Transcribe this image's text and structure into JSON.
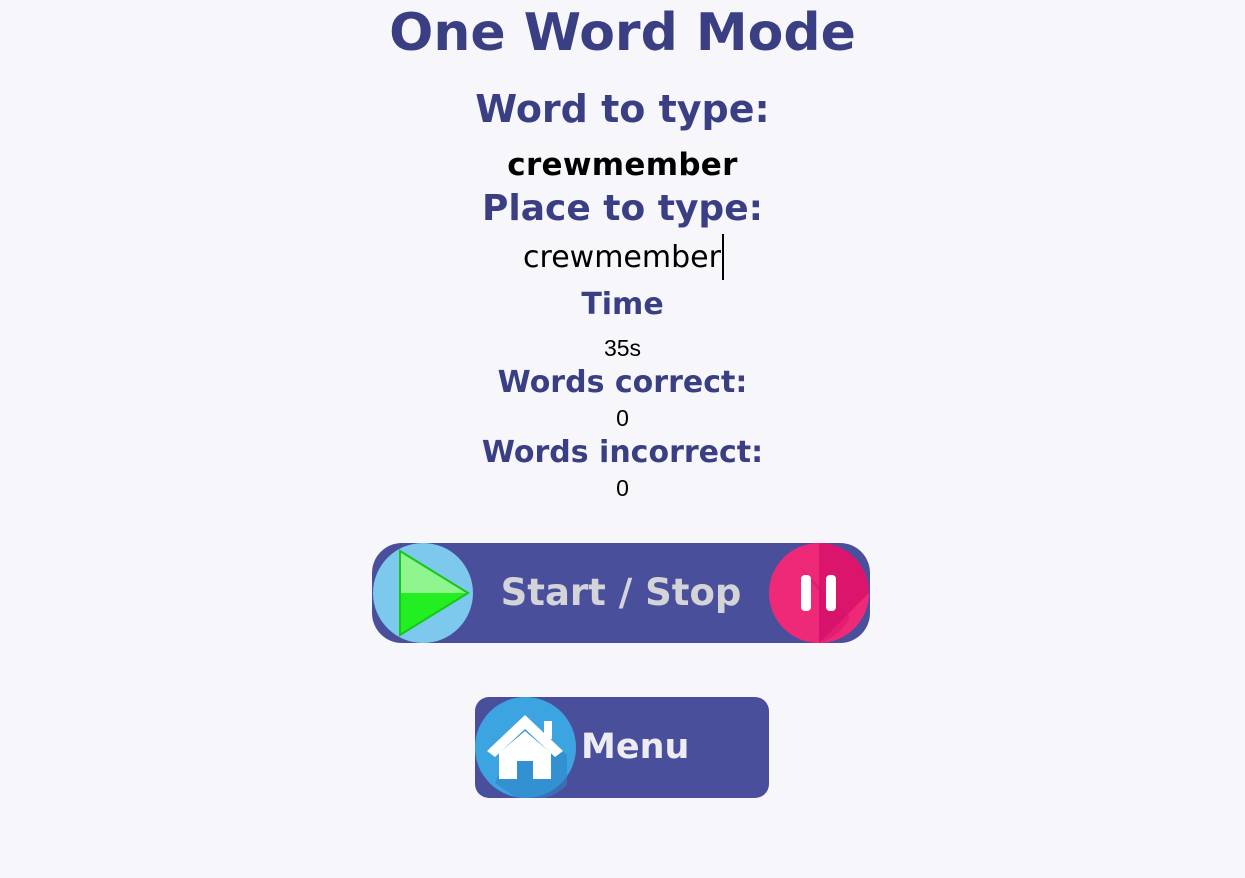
{
  "page": {
    "title": "One Word Mode"
  },
  "word_to_type": {
    "label": "Word to type:",
    "word": "crewmember"
  },
  "place_to_type": {
    "label": "Place to type:",
    "value": "crewmember"
  },
  "time": {
    "label": "Time",
    "value": "35s"
  },
  "words_correct": {
    "label": "Words correct:",
    "value": "0"
  },
  "words_incorrect": {
    "label": "Words incorrect:",
    "value": "0"
  },
  "buttons": {
    "start_stop": {
      "label": "Start / Stop",
      "left_icon": "play-icon",
      "right_icon": "pause-icon"
    },
    "menu": {
      "label": "Menu",
      "icon": "home-icon"
    }
  },
  "colors": {
    "heading": "#3a3f84",
    "button_bg": "#4a4f9c",
    "play_circle": "#7dc9ee",
    "play_triangle": "#22ee22",
    "pause_circle": "#ee2a78",
    "home_circle": "#3da4e2",
    "page_bg": "#f7f7fb"
  }
}
